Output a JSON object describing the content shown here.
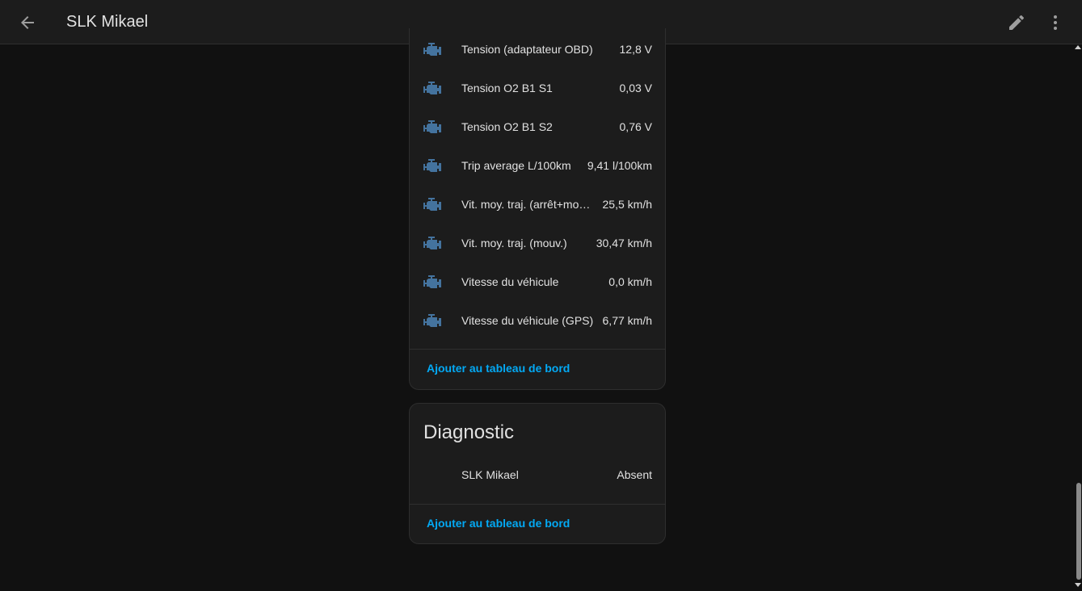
{
  "header": {
    "title": "SLK Mikael",
    "back_icon": "arrow-left-icon",
    "edit_icon": "pencil-icon",
    "more_icon": "dots-vertical-icon"
  },
  "sensors": {
    "icon": "engine-icon",
    "icon_color": "#44739e",
    "rows": [
      {
        "label": "Tension (adaptateur OBD)",
        "value": "12,8 V"
      },
      {
        "label": "Tension O2 B1 S1",
        "value": "0,03 V"
      },
      {
        "label": "Tension O2 B1 S2",
        "value": "0,76 V"
      },
      {
        "label": "Trip average L/100km",
        "value": "9,41 l/100km"
      },
      {
        "label": "Vit. moy. traj. (arrêt+mo…",
        "value": "25,5 km/h"
      },
      {
        "label": "Vit. moy. traj. (mouv.)",
        "value": "30,47 km/h"
      },
      {
        "label": "Vitesse du véhicule",
        "value": "0,0 km/h"
      },
      {
        "label": "Vitesse du véhicule (GPS)",
        "value": "6,77 km/h"
      }
    ],
    "add_label": "Ajouter au tableau de bord"
  },
  "diagnostic": {
    "title": "Diagnostic",
    "rows": [
      {
        "label": "SLK Mikael",
        "value": "Absent"
      }
    ],
    "add_label": "Ajouter au tableau de bord"
  },
  "colors": {
    "accent": "#03a9f4",
    "background": "#111111",
    "card": "#1c1c1c"
  }
}
